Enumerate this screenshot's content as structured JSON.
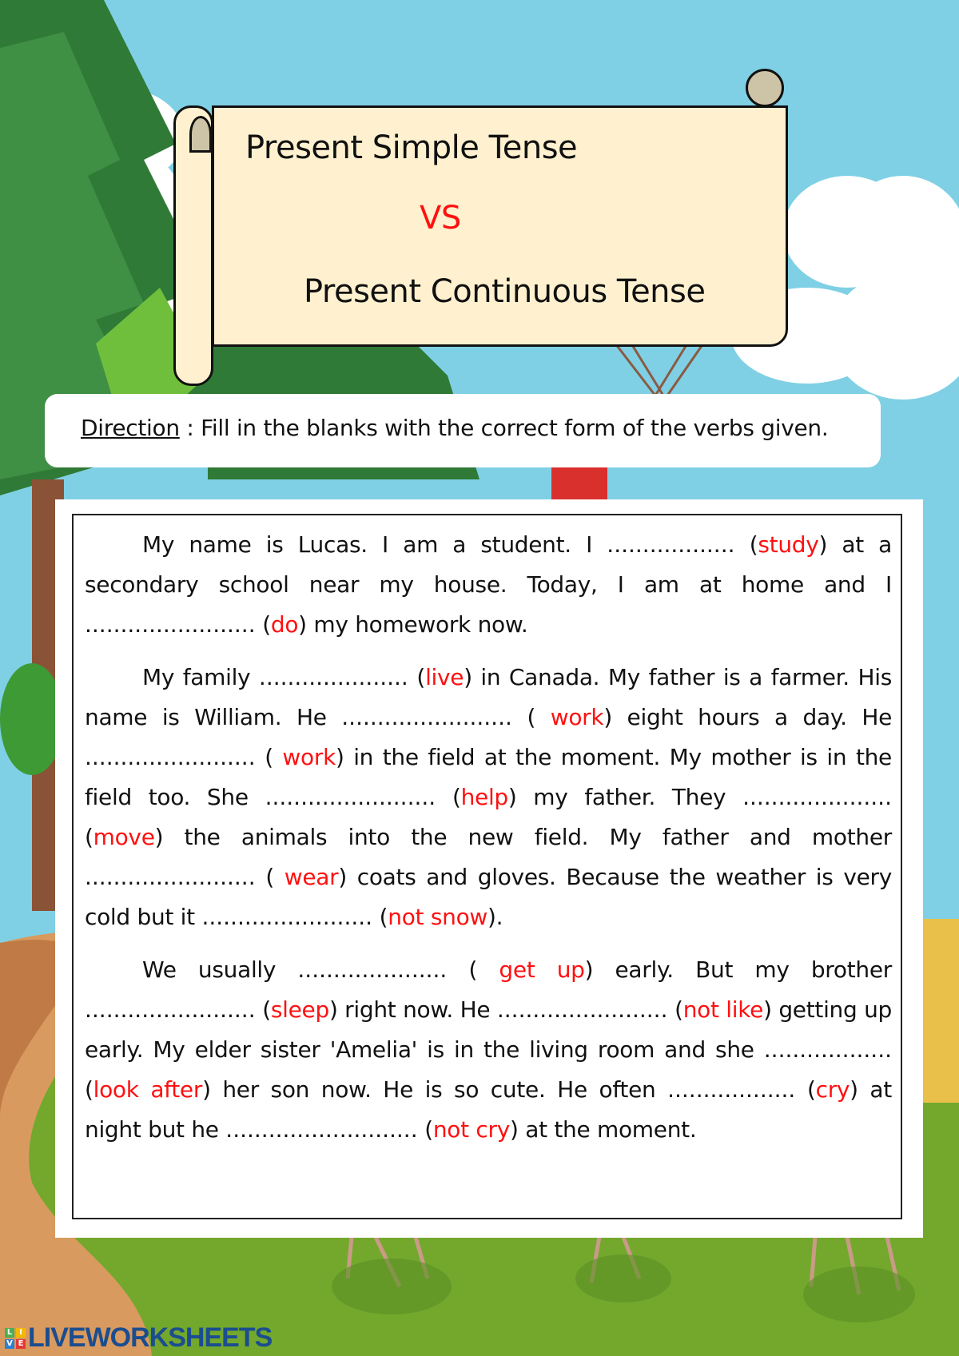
{
  "header": {
    "title_line1": "Present Simple Tense",
    "vs": "VS",
    "title_line2": "Present Continuous Tense"
  },
  "direction": {
    "label": "Direction",
    "separator": " : ",
    "text": "Fill in the blanks with the correct form of the verbs given."
  },
  "passage": {
    "paragraphs": [
      [
        {
          "t": "My name is Lucas. I am a student. I "
        },
        {
          "b": ".................."
        },
        {
          "t": " ("
        },
        {
          "v": "study"
        },
        {
          "t": ") at a secondary school near my house. Today, I am at home and I "
        },
        {
          "b": "........................"
        },
        {
          "t": " ("
        },
        {
          "v": "do"
        },
        {
          "t": ") my homework now."
        }
      ],
      [
        {
          "t": "My family "
        },
        {
          "b": "....................."
        },
        {
          "t": " ("
        },
        {
          "v": "live"
        },
        {
          "t": ") in Canada. My father is a farmer. His name is William. He "
        },
        {
          "b": "........................"
        },
        {
          "t": " ( "
        },
        {
          "v": "work"
        },
        {
          "t": ") eight hours a day. He "
        },
        {
          "b": "........................"
        },
        {
          "t": " ( "
        },
        {
          "v": "work"
        },
        {
          "t": ") in the field at the moment. My mother is in the field too. She "
        },
        {
          "b": "........................"
        },
        {
          "t": " ("
        },
        {
          "v": "help"
        },
        {
          "t": ") my father. They "
        },
        {
          "b": "....................."
        },
        {
          "t": " ("
        },
        {
          "v": "move"
        },
        {
          "t": ") the animals into the new field. My father and mother "
        },
        {
          "b": "........................"
        },
        {
          "t": " ( "
        },
        {
          "v": "wear"
        },
        {
          "t": ") coats and gloves. Because the weather is very cold but it "
        },
        {
          "b": "........................"
        },
        {
          "t": " ("
        },
        {
          "v": "not snow"
        },
        {
          "t": ")."
        }
      ],
      [
        {
          "t": "We usually "
        },
        {
          "b": "....................."
        },
        {
          "t": " ( "
        },
        {
          "v": "get up"
        },
        {
          "t": ") early. But my brother "
        },
        {
          "b": "........................"
        },
        {
          "t": " ("
        },
        {
          "v": "sleep"
        },
        {
          "t": ") right now. He "
        },
        {
          "b": "........................"
        },
        {
          "t": " ("
        },
        {
          "v": "not like"
        },
        {
          "t": ") getting up early. My elder sister 'Amelia' is in the living room and she "
        },
        {
          "b": ".................."
        },
        {
          "t": " ("
        },
        {
          "v": "look after"
        },
        {
          "t": ") her son now. He is so cute. He often "
        },
        {
          "b": ".................."
        },
        {
          "t": " ("
        },
        {
          "v": "cry"
        },
        {
          "t": ") at night but he "
        },
        {
          "b": "..........................."
        },
        {
          "t": " ("
        },
        {
          "v": "not cry"
        },
        {
          "t": ") at the moment."
        }
      ]
    ]
  },
  "footer": {
    "logo_cells": [
      "L",
      "I",
      "V",
      "E"
    ],
    "logo_text": "LIVEWORKSHEETS"
  },
  "colors": {
    "verb_hint": "#ff1010",
    "scroll_fill": "#fff1cf",
    "sky": "#7fd0e4",
    "logo_blue": "#1b4d8f"
  }
}
